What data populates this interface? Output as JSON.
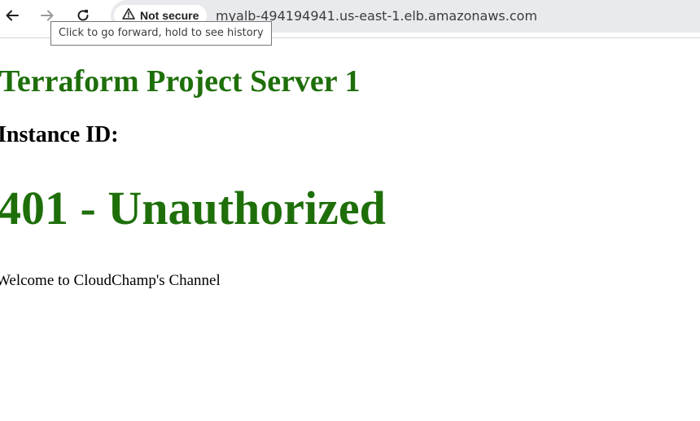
{
  "browser": {
    "security_label": "Not secure",
    "url": "myalb-494194941.us-east-1.elb.amazonaws.com",
    "tooltip": "Click to go forward, hold to see history",
    "icons": {
      "back": "back-arrow-icon",
      "forward": "forward-arrow-icon",
      "reload": "reload-icon",
      "security": "warning-triangle-icon"
    }
  },
  "page": {
    "title": "Terraform Project Server 1",
    "instance_heading": "Instance ID:",
    "status": "401 - Unauthorized",
    "welcome": "Welcome to CloudChamp's Channel"
  },
  "colors": {
    "heading_green": "#1e6f0a",
    "omnibox_bg": "#e9eaed"
  }
}
